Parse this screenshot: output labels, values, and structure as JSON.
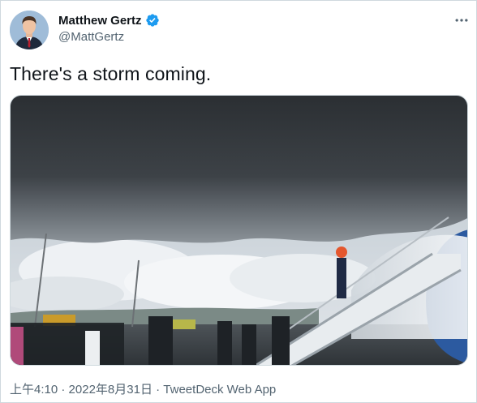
{
  "author": {
    "display_name": "Matthew Gertz",
    "handle": "@MattGertz",
    "verified": true,
    "avatar_icon": "user-avatar"
  },
  "tweet": {
    "text": "There's a storm coming.",
    "media_description_icon": "photo"
  },
  "meta": {
    "time": "上午4:10",
    "separator": " · ",
    "date": "2022年8月31日",
    "source": "TweetDeck Web App"
  },
  "colors": {
    "text_primary": "#0f1419",
    "text_secondary": "#536471",
    "verified_blue": "#1d9bf0",
    "border": "#cfd9de"
  }
}
